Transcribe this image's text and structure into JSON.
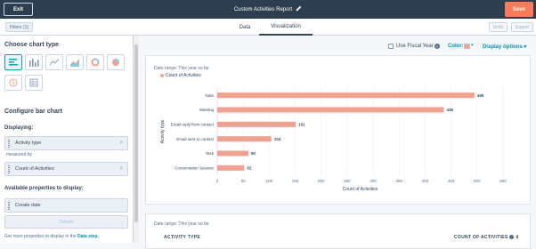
{
  "header": {
    "exit_label": "Exit",
    "title": "Custom Activities Report",
    "save_label": "Save"
  },
  "subbar": {
    "filters_label": "Filters (1)",
    "tabs": [
      "Data",
      "Visualization"
    ],
    "active_tab": "Visualization",
    "undo_label": "Undo",
    "export_label": "Export"
  },
  "left_panel": {
    "choose_chart_heading": "Choose chart type",
    "chart_types": [
      "bar-horizontal-icon",
      "bar-vertical-icon",
      "line-icon",
      "area-icon",
      "donut-icon",
      "pie-icon",
      "badge-icon",
      "table-icon"
    ],
    "selected_chart_type": "bar-horizontal-icon",
    "configure_heading": "Configure bar chart",
    "displaying_label": "Displaying:",
    "displaying_property": "Activity type",
    "measured_by_label": "measured by",
    "measured_property": "Count of Activities",
    "available_label": "Available properties to display:",
    "available_property": "Create date",
    "details_label": "Details",
    "footnote_prefix": "Get more properties to display in the",
    "footnote_link": "Data step."
  },
  "toolbar": {
    "fiscal_year_label": "Use Fiscal Year",
    "fiscal_year_checked": false,
    "color_label": "Color:",
    "display_options_label": "Display options"
  },
  "colors": {
    "bar": "#f2a18e",
    "accent": "#0091ae",
    "header_bg": "#2d3e50",
    "save_bg": "#ff7a59"
  },
  "chart_card": {
    "date_range": "Date range: This year so far",
    "legend": "Count of Activities"
  },
  "chart_data": {
    "type": "bar",
    "orientation": "horizontal",
    "categories": [
      "Note",
      "Meeting",
      "Email reply from contact",
      "Email sent to contact",
      "Task",
      "Conversation Session"
    ],
    "values": [
      495,
      436,
      151,
      104,
      60,
      52
    ],
    "xlabel": "Count of Activities",
    "ylabel": "Activity type",
    "xlim": [
      0,
      550
    ],
    "xticks": [
      0,
      50,
      100,
      150,
      200,
      250,
      300,
      350,
      400,
      450,
      500,
      550
    ],
    "legend": [
      "Count of Activities"
    ],
    "grid": true
  },
  "table_card": {
    "date_range": "Date range: This year so far",
    "col1": "ACTIVITY TYPE",
    "col2": "COUNT OF ACTIVITIES"
  }
}
